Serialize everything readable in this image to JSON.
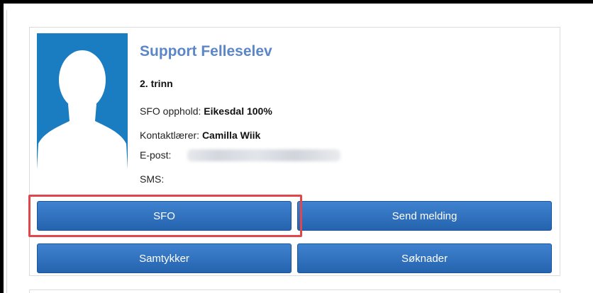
{
  "student": {
    "name": "Support Felleselev",
    "grade": "2. trinn",
    "sfo_label": "SFO opphold:",
    "sfo_value": "Eikesdal 100%",
    "contact_label": "Kontaktlærer:",
    "contact_value": "Camilla Wiik",
    "email_label": "E-post:",
    "sms_label": "SMS:"
  },
  "buttons": {
    "sfo": "SFO",
    "send_message": "Send melding",
    "consent": "Samtykker",
    "applications": "Søknader"
  },
  "colors": {
    "name_accent": "#5b86c7",
    "button_blue": "#2f6fbe",
    "avatar_blue": "#1a7cc1",
    "highlight_red": "#e0464a"
  },
  "icons": {
    "avatar": "person-silhouette-icon"
  }
}
